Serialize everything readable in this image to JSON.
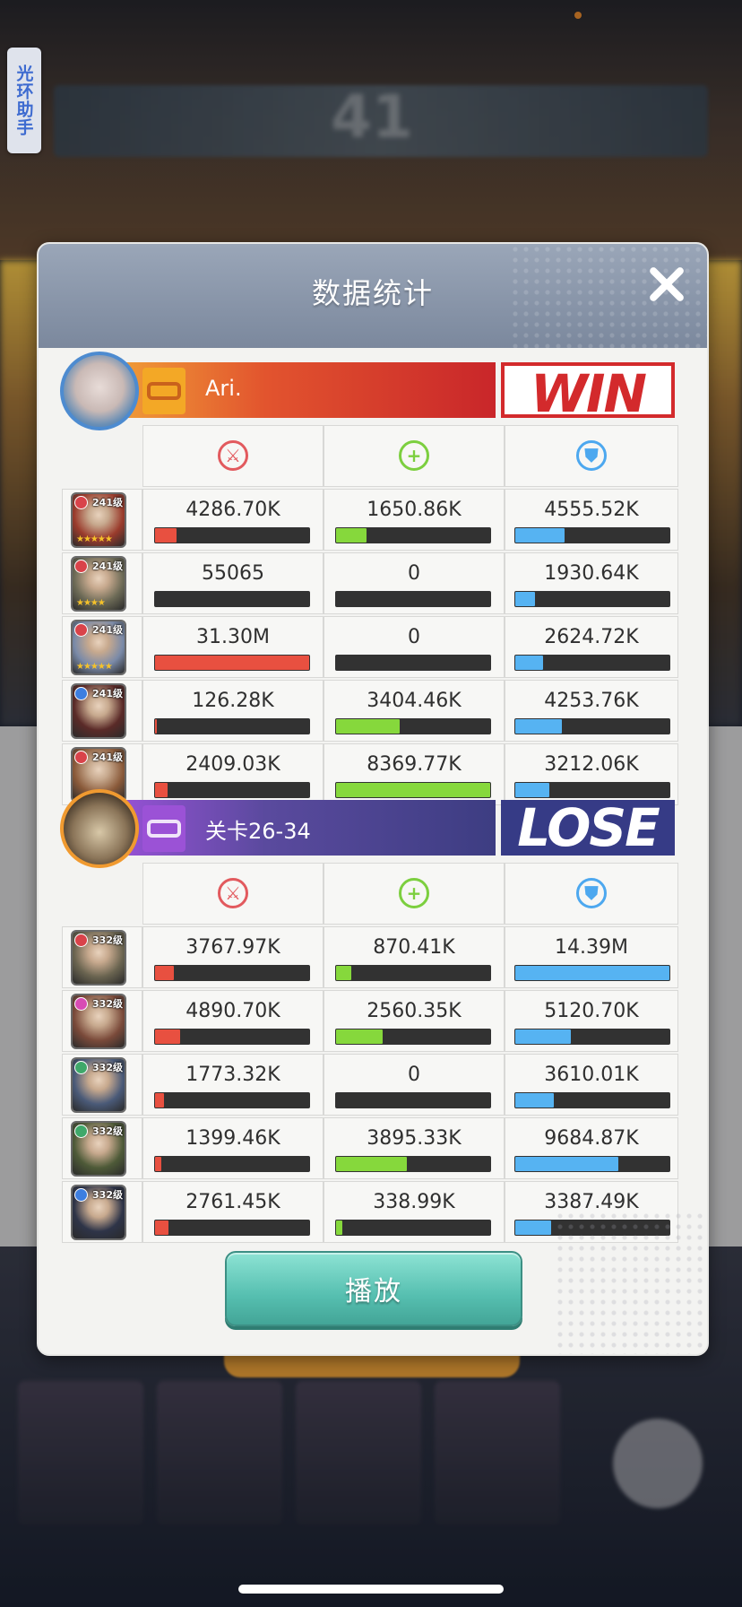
{
  "helper": {
    "label": "光环助手"
  },
  "background": {
    "score": "41"
  },
  "modal": {
    "title": "数据统计",
    "play_label": "播放"
  },
  "stat_icons": [
    "damage-icon",
    "heal-icon",
    "defense-icon"
  ],
  "colors": {
    "damage": "#e85040",
    "heal": "#86d83c",
    "defense": "#56b3f2",
    "win": "#d32a2c",
    "lose_bg": "#363b86"
  },
  "team1": {
    "name": "Ari.",
    "result": "WIN",
    "heroes": [
      {
        "level": "241级",
        "element": "#d9434a",
        "stars": "★★★★★",
        "face": "#9a3b2c",
        "damage": "4286.70K",
        "damage_fill": 0.14,
        "heal": "1650.86K",
        "heal_fill": 0.2,
        "defense": "4555.52K",
        "defense_fill": 0.32
      },
      {
        "level": "241级",
        "element": "#d9434a",
        "stars": "★★★★",
        "face": "#6c6a56",
        "damage": "55065",
        "damage_fill": 0.0,
        "heal": "0",
        "heal_fill": 0.0,
        "defense": "1930.64K",
        "defense_fill": 0.13
      },
      {
        "level": "241级",
        "element": "#d9434a",
        "stars": "★★★★★",
        "face": "#7a8aa8",
        "damage": "31.30M",
        "damage_fill": 1.0,
        "heal": "0",
        "heal_fill": 0.0,
        "defense": "2624.72K",
        "defense_fill": 0.18
      },
      {
        "level": "241级",
        "element": "#3d7ee0",
        "stars": "",
        "face": "#5a2a28",
        "damage": "126.28K",
        "damage_fill": 0.01,
        "heal": "3404.46K",
        "heal_fill": 0.41,
        "defense": "4253.76K",
        "defense_fill": 0.3
      },
      {
        "level": "241级",
        "element": "#d9434a",
        "stars": "",
        "face": "#8a5a3a",
        "damage": "2409.03K",
        "damage_fill": 0.08,
        "heal": "8369.77K",
        "heal_fill": 1.0,
        "defense": "3212.06K",
        "defense_fill": 0.22
      }
    ]
  },
  "team2": {
    "name": "关卡26-34",
    "result": "LOSE",
    "heroes": [
      {
        "level": "332级",
        "element": "#d9434a",
        "stars": "",
        "face": "#6a6450",
        "damage": "3767.97K",
        "damage_fill": 0.12,
        "heal": "870.41K",
        "heal_fill": 0.1,
        "defense": "14.39M",
        "defense_fill": 1.0
      },
      {
        "level": "332级",
        "element": "#d84bb4",
        "stars": "",
        "face": "#7a4a3a",
        "damage": "4890.70K",
        "damage_fill": 0.16,
        "heal": "2560.35K",
        "heal_fill": 0.3,
        "defense": "5120.70K",
        "defense_fill": 0.36
      },
      {
        "level": "332级",
        "element": "#3fa86a",
        "stars": "",
        "face": "#4a5a78",
        "damage": "1773.32K",
        "damage_fill": 0.06,
        "heal": "0",
        "heal_fill": 0.0,
        "defense": "3610.01K",
        "defense_fill": 0.25
      },
      {
        "level": "332级",
        "element": "#3fa86a",
        "stars": "",
        "face": "#4e5a38",
        "damage": "1399.46K",
        "damage_fill": 0.04,
        "heal": "3895.33K",
        "heal_fill": 0.46,
        "defense": "9684.87K",
        "defense_fill": 0.67
      },
      {
        "level": "332级",
        "element": "#3d7ee0",
        "stars": "",
        "face": "#2e3448",
        "damage": "2761.45K",
        "damage_fill": 0.09,
        "heal": "338.99K",
        "heal_fill": 0.04,
        "defense": "3387.49K",
        "defense_fill": 0.23
      }
    ]
  }
}
